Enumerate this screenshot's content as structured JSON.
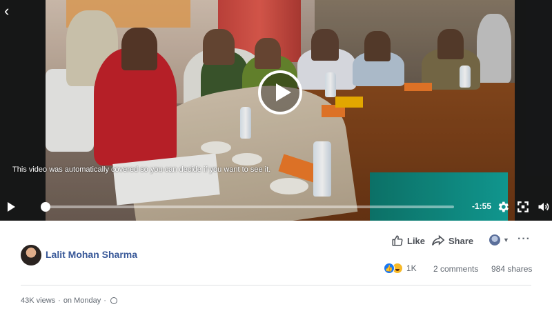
{
  "video": {
    "notice": "This video was automatically covered so you can decide if you want to see it.",
    "time_remaining": "-1:55",
    "progress_fraction": 0.0
  },
  "post": {
    "author": "Lalit Mohan Sharma",
    "like_label": "Like",
    "share_label": "Share",
    "reaction_count": "1K",
    "comments": "2 comments",
    "shares": "984 shares",
    "views": "43K views",
    "separator": "·",
    "posted": "on Monday"
  },
  "icons": [
    "back-arrow-icon",
    "play-icon",
    "settings-gear-icon",
    "fullscreen-icon",
    "volume-icon",
    "thumbs-up-icon",
    "share-arrow-icon",
    "globe-icon",
    "more-icon"
  ],
  "colors": {
    "author_link": "#385898",
    "like_reaction": "#1877f2",
    "haha_reaction": "#f7b928"
  }
}
